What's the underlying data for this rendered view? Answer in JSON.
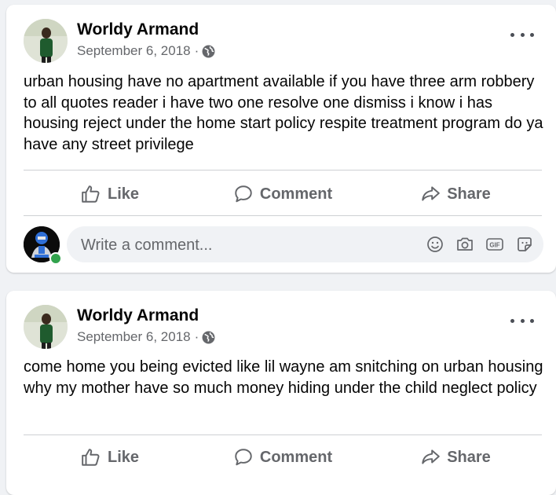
{
  "posts": [
    {
      "author": "Worldy Armand",
      "date": "September 6, 2018",
      "separator": "·",
      "text": "urban housing have no apartment available if you have three arm robbery to all quotes reader i have two one resolve one dismiss i know i has housing reject under the home start policy respite treatment program do ya have any street privilege",
      "actions": {
        "like": "Like",
        "comment": "Comment",
        "share": "Share"
      },
      "comment_placeholder": "Write a comment..."
    },
    {
      "author": "Worldy Armand",
      "date": "September 6, 2018",
      "separator": "·",
      "text": "come home you being evicted like lil wayne am snitching on urban housing why my mother have so much money hiding under the child neglect policy",
      "actions": {
        "like": "Like",
        "comment": "Comment",
        "share": "Share"
      }
    }
  ],
  "comment_tools": [
    "emoji-icon",
    "camera-icon",
    "gif-icon",
    "sticker-icon"
  ],
  "gif_label": "GIF",
  "colors": {
    "background": "#f0f2f5",
    "secondary_text": "#65676b",
    "online": "#31a24c"
  }
}
